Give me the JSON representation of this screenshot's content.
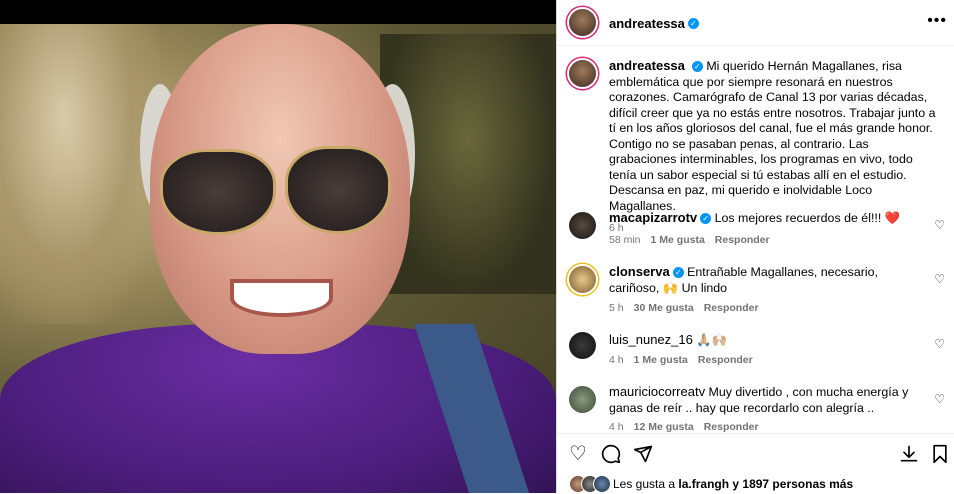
{
  "post": {
    "author": "andreatessa",
    "caption": "Mi querido Hernán Magallanes, risa emblemática que por siempre resonará en nuestros corazones. Camarógrafo de Canal 13 por varias décadas, difícil creer que ya no estás entre nosotros. Trabajar junto a tí en los años gloriosos del canal, fue el más grande honor. Contigo no se pasaban penas, al contrario. Las grabaciones interminables, los programas en vivo, todo tenía un sabor especial si tú estabas allí en el estudio. Descansa en paz, mi querido e inolvidable Loco Magallanes.",
    "time": "6 h"
  },
  "comments": [
    {
      "user": "macapizarrotv",
      "text": "Los mejores recuerdos de él!!! ❤️",
      "time": "58 min",
      "likes": "1 Me gusta",
      "reply": "Responder"
    },
    {
      "user": "clonserva",
      "text": "Entrañable Magallanes, necesario, cariñoso, 🙌 Un lindo",
      "time": "5 h",
      "likes": "30 Me gusta",
      "reply": "Responder"
    },
    {
      "user": "luis_nunez_16",
      "text": "🙏🏼🙌🏼",
      "time": "4 h",
      "likes": "1 Me gusta",
      "reply": "Responder"
    },
    {
      "user": "mauriciocorreatv",
      "text": "Muy divertido , con mucha energía y ganas de reír .. hay que recordarlo con alegría ..",
      "time": "4 h",
      "likes": "12 Me gusta",
      "reply": "Responder"
    }
  ],
  "actions": {
    "like_icon": "heart-icon",
    "comment_icon": "comment-icon",
    "share_icon": "share-icon",
    "save_icon": "bookmark-icon",
    "download_icon": "download-icon"
  },
  "likes_summary": {
    "prefix": "Les gusta a ",
    "user": "la.frangh",
    "suffix": " y 1897 personas más"
  },
  "colors": {
    "accent": "#0095f6",
    "story_ring": "#d62976"
  }
}
